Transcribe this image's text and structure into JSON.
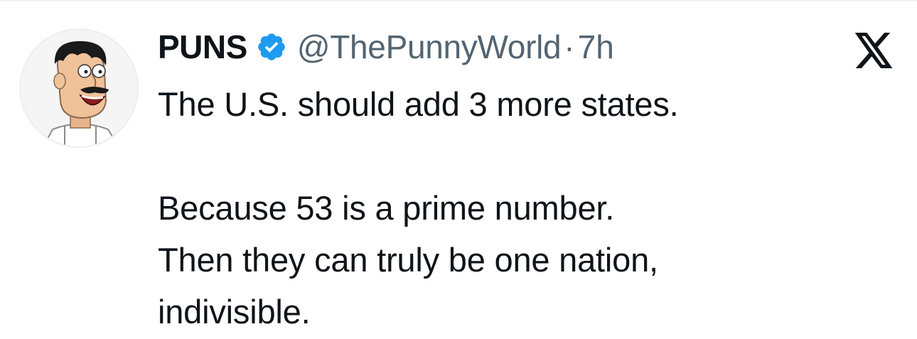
{
  "tweet": {
    "display_name": "PUNS",
    "handle": "@ThePunnyWorld",
    "separator": "·",
    "timestamp": "7h",
    "verified": true,
    "text": {
      "line1": "The U.S. should add 3 more states.",
      "line2": "Because 53 is a prime number.",
      "line3": "Then they can truly be one nation,",
      "line4": "indivisible."
    }
  },
  "icons": {
    "avatar": "cartoon-man-mustache-avatar",
    "verified": "verified-badge-icon",
    "brand": "x-logo-icon"
  },
  "colors": {
    "verified_blue": "#1d9bf0",
    "text_primary": "#0f1419",
    "text_secondary": "#536471"
  }
}
